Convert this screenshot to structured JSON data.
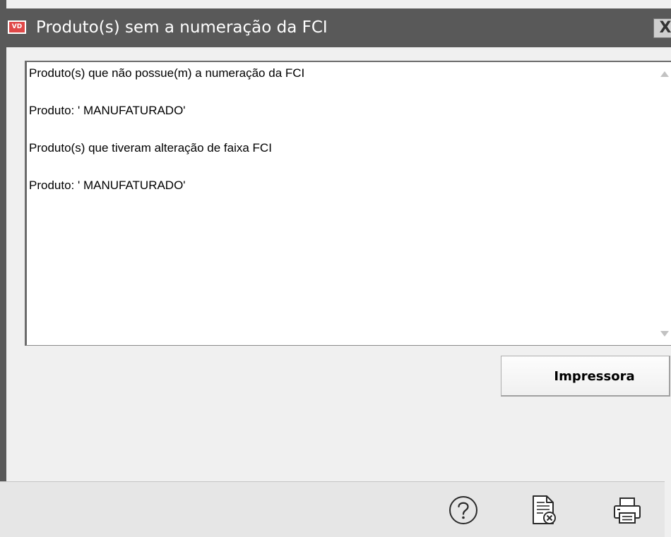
{
  "window": {
    "logo_text": "VD",
    "title": "Produto(s) sem a numeração da FCI",
    "close_label": "X"
  },
  "memo": {
    "lines": [
      "Produto(s) que não possue(m) a numeração da FCI",
      "Produto: ' MANUFATURADO'",
      "Produto(s) que tiveram alteração de faixa FCI",
      "Produto: ' MANUFATURADO'"
    ]
  },
  "actions": {
    "print_button_label": "Impressora"
  },
  "footer": {
    "icons": [
      "help-icon",
      "cancel-document-icon",
      "printer-icon"
    ]
  },
  "colors": {
    "titlebar": "#595959",
    "window_bg": "#f0f0f0",
    "memo_bg": "#ffffff",
    "footer_bg": "#e6e6e6",
    "logo_bg": "#e04848"
  }
}
